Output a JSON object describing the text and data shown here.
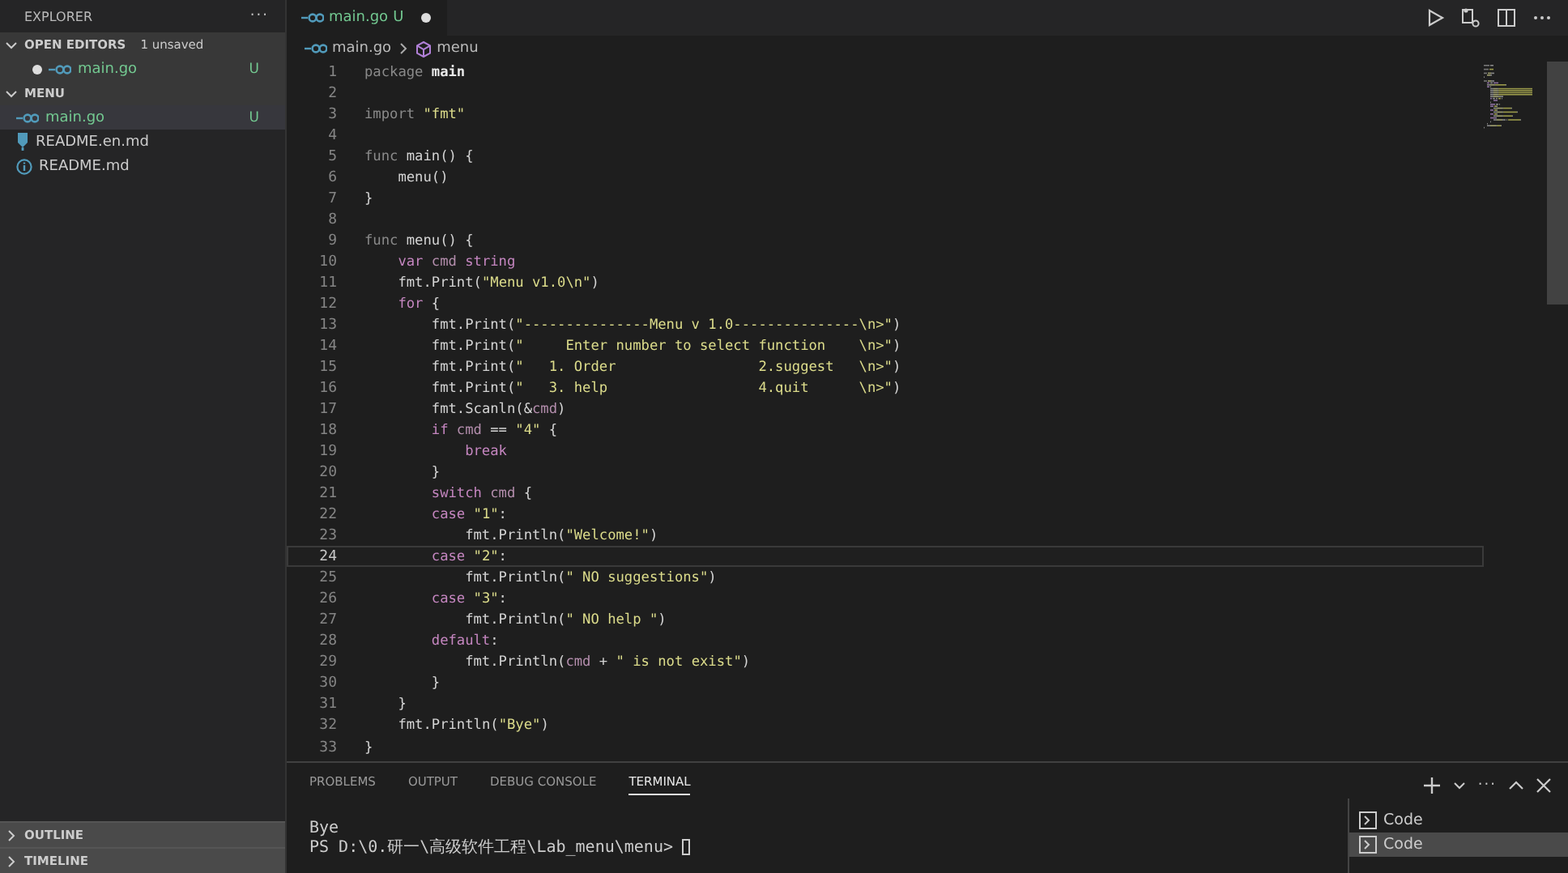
{
  "sidebar": {
    "title": "EXPLORER",
    "more": "···",
    "open_editors": {
      "label": "OPEN EDITORS",
      "badge": "1 unsaved",
      "expanded": true,
      "items": [
        {
          "name": "main.go",
          "status": "U",
          "unsaved": true,
          "kind": "go"
        }
      ]
    },
    "folder": {
      "label": "MENU",
      "expanded": true,
      "children": [
        {
          "name": "main.go",
          "status": "U",
          "selected": true,
          "kind": "go"
        },
        {
          "name": "README.en.md",
          "selected": false,
          "kind": "pin"
        },
        {
          "name": "README.md",
          "selected": false,
          "kind": "info"
        }
      ]
    },
    "collapsed": [
      {
        "label": "OUTLINE",
        "expanded": false
      },
      {
        "label": "TIMELINE",
        "expanded": false
      }
    ]
  },
  "tabs": [
    {
      "name": "main.go",
      "status": "U",
      "unsaved": true,
      "selected": true,
      "kind": "go"
    }
  ],
  "breadcrumb": [
    {
      "text": "main.go",
      "kind": "go"
    },
    {
      "text": "menu",
      "kind": "symbol"
    }
  ],
  "editor": {
    "lines": [
      {
        "number": "1",
        "current": false,
        "tokens": [
          {
            "kind": "kw2",
            "text": "package"
          },
          {
            "kind": "id",
            "text": " main"
          }
        ]
      },
      {
        "number": "2",
        "current": false
      },
      {
        "number": "3",
        "current": false,
        "tokens": [
          {
            "kind": "kw2",
            "text": "import"
          },
          {
            "kind": "str",
            "text": " \"fmt\""
          }
        ]
      },
      {
        "number": "4",
        "current": false
      },
      {
        "number": "5",
        "current": false,
        "tokens": [
          {
            "kind": "kw2",
            "text": "func"
          },
          {
            "kind": "fn",
            "text": " main"
          },
          {
            "kind": "p",
            "text": "() {"
          }
        ]
      },
      {
        "number": "6",
        "current": false,
        "tokens": [
          {
            "kind": "fn",
            "text": "    menu"
          },
          {
            "kind": "p",
            "text": "()"
          }
        ]
      },
      {
        "number": "7",
        "current": false,
        "tokens": [
          {
            "kind": "p",
            "text": "}"
          }
        ]
      },
      {
        "number": "8",
        "current": false
      },
      {
        "number": "9",
        "current": false,
        "tokens": [
          {
            "kind": "kw2",
            "text": "func"
          },
          {
            "kind": "fn",
            "text": " menu"
          },
          {
            "kind": "p",
            "text": "() {"
          }
        ]
      },
      {
        "number": "10",
        "current": false,
        "tokens": [
          {
            "kind": "kw",
            "text": "    var"
          },
          {
            "kind": "var",
            "text": " cmd"
          },
          {
            "kind": "kw",
            "text": " string"
          }
        ]
      },
      {
        "number": "11",
        "current": false,
        "tokens": [
          {
            "kind": "p",
            "text": "    fmt."
          },
          {
            "kind": "fn",
            "text": "Print"
          },
          {
            "kind": "p",
            "text": "("
          },
          {
            "kind": "str",
            "text": "\"Menu v1.0\\n\""
          },
          {
            "kind": "p",
            "text": ")"
          }
        ]
      },
      {
        "number": "12",
        "current": false,
        "tokens": [
          {
            "kind": "kw",
            "text": "    for"
          },
          {
            "kind": "p",
            "text": " {"
          }
        ]
      },
      {
        "number": "13",
        "current": false,
        "tokens": [
          {
            "kind": "p",
            "text": "        fmt."
          },
          {
            "kind": "fn",
            "text": "Print"
          },
          {
            "kind": "p",
            "text": "("
          },
          {
            "kind": "str",
            "text": "\"---------------Menu v 1.0---------------\\n>\""
          },
          {
            "kind": "p",
            "text": ")"
          }
        ]
      },
      {
        "number": "14",
        "current": false,
        "tokens": [
          {
            "kind": "p",
            "text": "        fmt."
          },
          {
            "kind": "fn",
            "text": "Print"
          },
          {
            "kind": "p",
            "text": "("
          },
          {
            "kind": "str",
            "text": "\"     Enter number to select function    \\n>\""
          },
          {
            "kind": "p",
            "text": ")"
          }
        ]
      },
      {
        "number": "15",
        "current": false,
        "tokens": [
          {
            "kind": "p",
            "text": "        fmt."
          },
          {
            "kind": "fn",
            "text": "Print"
          },
          {
            "kind": "p",
            "text": "("
          },
          {
            "kind": "str",
            "text": "\"   1. Order                 2.suggest   \\n>\""
          },
          {
            "kind": "p",
            "text": ")"
          }
        ]
      },
      {
        "number": "16",
        "current": false,
        "tokens": [
          {
            "kind": "p",
            "text": "        fmt."
          },
          {
            "kind": "fn",
            "text": "Print"
          },
          {
            "kind": "p",
            "text": "("
          },
          {
            "kind": "str",
            "text": "\"   3. help                  4.quit      \\n>\""
          },
          {
            "kind": "p",
            "text": ")"
          }
        ]
      },
      {
        "number": "17",
        "current": false,
        "tokens": [
          {
            "kind": "p",
            "text": "        fmt."
          },
          {
            "kind": "fn",
            "text": "Scanln"
          },
          {
            "kind": "p",
            "text": "(&"
          },
          {
            "kind": "var",
            "text": "cmd"
          },
          {
            "kind": "p",
            "text": ")"
          }
        ]
      },
      {
        "number": "18",
        "current": false,
        "tokens": [
          {
            "kind": "kw",
            "text": "        if"
          },
          {
            "kind": "var",
            "text": " cmd"
          },
          {
            "kind": "p",
            "text": " =="
          },
          {
            "kind": "str",
            "text": " \"4\""
          },
          {
            "kind": "p",
            "text": " {"
          }
        ]
      },
      {
        "number": "19",
        "current": false,
        "tokens": [
          {
            "kind": "kw",
            "text": "            break"
          }
        ]
      },
      {
        "number": "20",
        "current": false,
        "tokens": [
          {
            "kind": "p",
            "text": "        }"
          }
        ]
      },
      {
        "number": "21",
        "current": false,
        "tokens": [
          {
            "kind": "kw",
            "text": "        switch"
          },
          {
            "kind": "var",
            "text": " cmd"
          },
          {
            "kind": "p",
            "text": " {"
          }
        ]
      },
      {
        "number": "22",
        "current": false,
        "tokens": [
          {
            "kind": "kw",
            "text": "        case"
          },
          {
            "kind": "str",
            "text": " \"1\""
          },
          {
            "kind": "p",
            "text": ":"
          }
        ]
      },
      {
        "number": "23",
        "current": false,
        "tokens": [
          {
            "kind": "p",
            "text": "            fmt."
          },
          {
            "kind": "fn",
            "text": "Println"
          },
          {
            "kind": "p",
            "text": "("
          },
          {
            "kind": "str",
            "text": "\"Welcome!\""
          },
          {
            "kind": "p",
            "text": ")"
          }
        ]
      },
      {
        "number": "24",
        "current": true,
        "tokens": [
          {
            "kind": "kw",
            "text": "        case"
          },
          {
            "kind": "str",
            "text": " \"2\""
          },
          {
            "kind": "p",
            "text": ":"
          }
        ]
      },
      {
        "number": "25",
        "current": false,
        "tokens": [
          {
            "kind": "p",
            "text": "            fmt."
          },
          {
            "kind": "fn",
            "text": "Println"
          },
          {
            "kind": "p",
            "text": "("
          },
          {
            "kind": "str",
            "text": "\" NO suggestions\""
          },
          {
            "kind": "p",
            "text": ")"
          }
        ]
      },
      {
        "number": "26",
        "current": false,
        "tokens": [
          {
            "kind": "kw",
            "text": "        case"
          },
          {
            "kind": "str",
            "text": " \"3\""
          },
          {
            "kind": "p",
            "text": ":"
          }
        ]
      },
      {
        "number": "27",
        "current": false,
        "tokens": [
          {
            "kind": "p",
            "text": "            fmt."
          },
          {
            "kind": "fn",
            "text": "Println"
          },
          {
            "kind": "p",
            "text": "("
          },
          {
            "kind": "str",
            "text": "\" NO help \""
          },
          {
            "kind": "p",
            "text": ")"
          }
        ]
      },
      {
        "number": "28",
        "current": false,
        "tokens": [
          {
            "kind": "kw",
            "text": "        default"
          },
          {
            "kind": "p",
            "text": ":"
          }
        ]
      },
      {
        "number": "29",
        "current": false,
        "tokens": [
          {
            "kind": "p",
            "text": "            fmt."
          },
          {
            "kind": "fn",
            "text": "Println"
          },
          {
            "kind": "p",
            "text": "("
          },
          {
            "kind": "var",
            "text": "cmd"
          },
          {
            "kind": "p",
            "text": " +"
          },
          {
            "kind": "str",
            "text": " \" is not exist\""
          },
          {
            "kind": "p",
            "text": ")"
          }
        ]
      },
      {
        "number": "30",
        "current": false,
        "tokens": [
          {
            "kind": "p",
            "text": "        }"
          }
        ]
      },
      {
        "number": "31",
        "current": false,
        "tokens": [
          {
            "kind": "p",
            "text": "    }"
          }
        ]
      },
      {
        "number": "32",
        "current": false,
        "tokens": [
          {
            "kind": "p",
            "text": "    fmt."
          },
          {
            "kind": "fn",
            "text": "Println"
          },
          {
            "kind": "p",
            "text": "("
          },
          {
            "kind": "str",
            "text": "\"Bye\""
          },
          {
            "kind": "p",
            "text": ")"
          }
        ]
      },
      {
        "number": "33",
        "current": false,
        "tokens": [
          {
            "kind": "p",
            "text": "}"
          }
        ]
      }
    ]
  },
  "panel": {
    "tabs": [
      {
        "label": "PROBLEMS",
        "selected": false
      },
      {
        "label": "OUTPUT",
        "selected": false
      },
      {
        "label": "DEBUG CONSOLE",
        "selected": false
      },
      {
        "label": "TERMINAL",
        "selected": true
      }
    ],
    "more": "···",
    "terminal_lines": [
      "Bye",
      "PS D:\\0.研一\\高级软件工程\\Lab_menu\\menu>"
    ],
    "terminals": [
      {
        "label": "Code",
        "selected": false
      },
      {
        "label": "Code",
        "selected": true
      }
    ]
  }
}
